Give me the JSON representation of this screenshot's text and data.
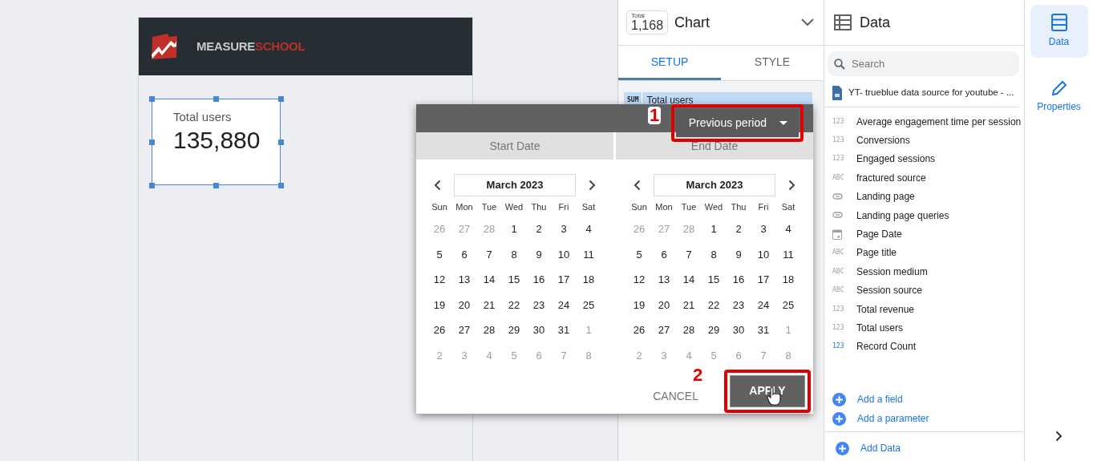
{
  "report": {
    "brand": [
      "MEASURE",
      "SCHOOL"
    ],
    "scorecard": {
      "label": "Total users",
      "value": "135,880"
    }
  },
  "properties_panel": {
    "total_label": "Total",
    "total_value": "1,168",
    "title": "Chart",
    "tabs": [
      {
        "label": "SETUP",
        "selected": true
      },
      {
        "label": "STYLE",
        "selected": false
      }
    ],
    "metric": {
      "aggregation": "SUM",
      "name": "Total users"
    }
  },
  "date_popup": {
    "comparison": "Previous period",
    "calendars": [
      {
        "heading": "Start Date",
        "month": "March 2023",
        "weekdays": [
          "Sun",
          "Mon",
          "Tue",
          "Wed",
          "Thu",
          "Fri",
          "Sat"
        ],
        "weeks": [
          [
            {
              "d": "26",
              "other_month": true
            },
            {
              "d": "27",
              "other_month": true
            },
            {
              "d": "28",
              "other_month": true
            },
            {
              "d": "1",
              "other_month": false
            },
            {
              "d": "2",
              "other_month": false
            },
            {
              "d": "3",
              "other_month": false
            },
            {
              "d": "4",
              "other_month": false
            }
          ],
          [
            {
              "d": "5",
              "other_month": false
            },
            {
              "d": "6",
              "other_month": false
            },
            {
              "d": "7",
              "other_month": false
            },
            {
              "d": "8",
              "other_month": false
            },
            {
              "d": "9",
              "other_month": false
            },
            {
              "d": "10",
              "other_month": false
            },
            {
              "d": "11",
              "other_month": false
            }
          ],
          [
            {
              "d": "12",
              "other_month": false
            },
            {
              "d": "13",
              "other_month": false
            },
            {
              "d": "14",
              "other_month": false
            },
            {
              "d": "15",
              "other_month": false
            },
            {
              "d": "16",
              "other_month": false
            },
            {
              "d": "17",
              "other_month": false
            },
            {
              "d": "18",
              "other_month": false
            }
          ],
          [
            {
              "d": "19",
              "other_month": false
            },
            {
              "d": "20",
              "other_month": false
            },
            {
              "d": "21",
              "other_month": false
            },
            {
              "d": "22",
              "other_month": false
            },
            {
              "d": "23",
              "other_month": false
            },
            {
              "d": "24",
              "other_month": false
            },
            {
              "d": "25",
              "other_month": false
            }
          ],
          [
            {
              "d": "26",
              "other_month": false
            },
            {
              "d": "27",
              "other_month": false
            },
            {
              "d": "28",
              "other_month": false
            },
            {
              "d": "29",
              "other_month": false
            },
            {
              "d": "30",
              "other_month": false
            },
            {
              "d": "31",
              "other_month": false
            },
            {
              "d": "1",
              "other_month": true
            }
          ],
          [
            {
              "d": "2",
              "other_month": true
            },
            {
              "d": "3",
              "other_month": true
            },
            {
              "d": "4",
              "other_month": true
            },
            {
              "d": "5",
              "other_month": true
            },
            {
              "d": "6",
              "other_month": true
            },
            {
              "d": "7",
              "other_month": true
            },
            {
              "d": "8",
              "other_month": true
            }
          ]
        ]
      },
      {
        "heading": "End Date",
        "month": "March 2023",
        "weekdays": [
          "Sun",
          "Mon",
          "Tue",
          "Wed",
          "Thu",
          "Fri",
          "Sat"
        ],
        "weeks": [
          [
            {
              "d": "26",
              "other_month": true
            },
            {
              "d": "27",
              "other_month": true
            },
            {
              "d": "28",
              "other_month": true
            },
            {
              "d": "1",
              "other_month": false
            },
            {
              "d": "2",
              "other_month": false
            },
            {
              "d": "3",
              "other_month": false
            },
            {
              "d": "4",
              "other_month": false
            }
          ],
          [
            {
              "d": "5",
              "other_month": false
            },
            {
              "d": "6",
              "other_month": false
            },
            {
              "d": "7",
              "other_month": false
            },
            {
              "d": "8",
              "other_month": false
            },
            {
              "d": "9",
              "other_month": false
            },
            {
              "d": "10",
              "other_month": false
            },
            {
              "d": "11",
              "other_month": false
            }
          ],
          [
            {
              "d": "12",
              "other_month": false
            },
            {
              "d": "13",
              "other_month": false
            },
            {
              "d": "14",
              "other_month": false
            },
            {
              "d": "15",
              "other_month": false
            },
            {
              "d": "16",
              "other_month": false
            },
            {
              "d": "17",
              "other_month": false
            },
            {
              "d": "18",
              "other_month": false
            }
          ],
          [
            {
              "d": "19",
              "other_month": false
            },
            {
              "d": "20",
              "other_month": false
            },
            {
              "d": "21",
              "other_month": false
            },
            {
              "d": "22",
              "other_month": false
            },
            {
              "d": "23",
              "other_month": false
            },
            {
              "d": "24",
              "other_month": false
            },
            {
              "d": "25",
              "other_month": false
            }
          ],
          [
            {
              "d": "26",
              "other_month": false
            },
            {
              "d": "27",
              "other_month": false
            },
            {
              "d": "28",
              "other_month": false
            },
            {
              "d": "29",
              "other_month": false
            },
            {
              "d": "30",
              "other_month": false
            },
            {
              "d": "31",
              "other_month": false
            },
            {
              "d": "1",
              "other_month": true
            }
          ],
          [
            {
              "d": "2",
              "other_month": true
            },
            {
              "d": "3",
              "other_month": true
            },
            {
              "d": "4",
              "other_month": true
            },
            {
              "d": "5",
              "other_month": true
            },
            {
              "d": "6",
              "other_month": true
            },
            {
              "d": "7",
              "other_month": true
            },
            {
              "d": "8",
              "other_month": true
            }
          ]
        ]
      }
    ],
    "cancel": "CANCEL",
    "apply": "APPLY",
    "annotations": [
      "1",
      "2"
    ]
  },
  "data_panel": {
    "title": "Data",
    "search": {
      "placeholder": "Search"
    },
    "source": "YT- trueblue data source for youtube - ...",
    "fields": [
      {
        "kind": "number",
        "type_label": "123",
        "name": "Average engagement time per session"
      },
      {
        "kind": "number",
        "type_label": "123",
        "name": "Conversions"
      },
      {
        "kind": "number",
        "type_label": "123",
        "name": "Engaged sessions"
      },
      {
        "kind": "text",
        "type_label": "ABC",
        "name": "fractured source"
      },
      {
        "kind": "link",
        "name": "Landing page"
      },
      {
        "kind": "link",
        "name": "Landing page queries"
      },
      {
        "kind": "date",
        "name": "Page Date"
      },
      {
        "kind": "text",
        "type_label": "ABC",
        "name": "Page title"
      },
      {
        "kind": "text",
        "type_label": "ABC",
        "name": "Session medium"
      },
      {
        "kind": "text",
        "type_label": "ABC",
        "name": "Session source"
      },
      {
        "kind": "number",
        "type_label": "123",
        "name": "Total revenue"
      },
      {
        "kind": "number",
        "type_label": "123",
        "name": "Total users"
      },
      {
        "kind": "calculated",
        "type_label": "123",
        "name": "Record Count"
      }
    ],
    "actions": [
      "Add a field",
      "Add a parameter"
    ],
    "add_data": "Add Data"
  },
  "rail": [
    {
      "kind": "data",
      "label": "Data",
      "selected": true
    },
    {
      "kind": "properties",
      "label": "Properties",
      "selected": false
    }
  ]
}
